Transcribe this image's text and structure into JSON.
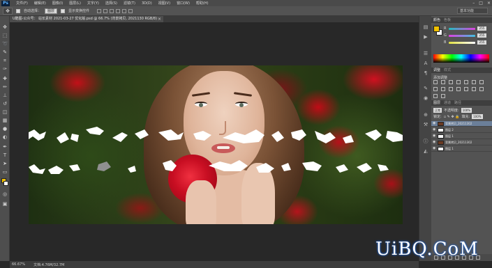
{
  "menubar": {
    "logo": "Ps",
    "items": [
      "文件(F)",
      "编辑(E)",
      "图像(I)",
      "图层(L)",
      "文字(Y)",
      "选择(S)",
      "滤镜(T)",
      "3D(D)",
      "视图(V)",
      "窗口(W)",
      "帮助(H)"
    ],
    "win_controls": [
      "–",
      "□",
      "×"
    ]
  },
  "options": {
    "auto_select_label": "自动选择：",
    "auto_select_value": "图层",
    "show_transform_label": "显示变换控件",
    "workspace": "基本功能"
  },
  "document": {
    "tab_title": "U酷图-公众号： 站长素材 2021-03-27 优化版.psd @ 66.7% (背景拷贝, 2021130 RGB/8)",
    "close": "×"
  },
  "statusbar": {
    "zoom": "66.67%",
    "doc_size": "文档:4.76M/32.7M"
  },
  "panels": {
    "color_tabs": [
      "颜色",
      "色板"
    ],
    "sliders": [
      {
        "label": "R",
        "value": "255",
        "color": "#e040e0"
      },
      {
        "label": "G",
        "value": "255",
        "color": "#40c0e0"
      },
      {
        "label": "B",
        "value": "255",
        "color": "#e0e040"
      }
    ],
    "adjust_tabs": [
      "调整",
      "样式"
    ],
    "adjust_title": "添加调整",
    "layer_tabs": [
      "图层",
      "通道",
      "路径"
    ],
    "blend_mode": "正常",
    "opacity_label": "不透明度:",
    "opacity_value": "100%",
    "fill_label": "填充:",
    "fill_value": "100%",
    "lock_label": "锁定:",
    "layers": [
      {
        "name": "背景拷贝_20211302",
        "thumb": "photo",
        "selected": true
      },
      {
        "name": "图层 2",
        "thumb": "white",
        "selected": false
      },
      {
        "name": "图层 1",
        "thumb": "white",
        "selected": false
      },
      {
        "name": "背景拷贝_20211302",
        "thumb": "photo",
        "selected": false
      },
      {
        "name": "图层 1",
        "thumb": "white",
        "selected": false
      }
    ]
  },
  "watermark": "UiBQ.CoM",
  "colors": {
    "foreground": "#f0c000",
    "background": "#ffffff",
    "ui_dark": "#282828",
    "selected_layer": "#6b7f99"
  }
}
